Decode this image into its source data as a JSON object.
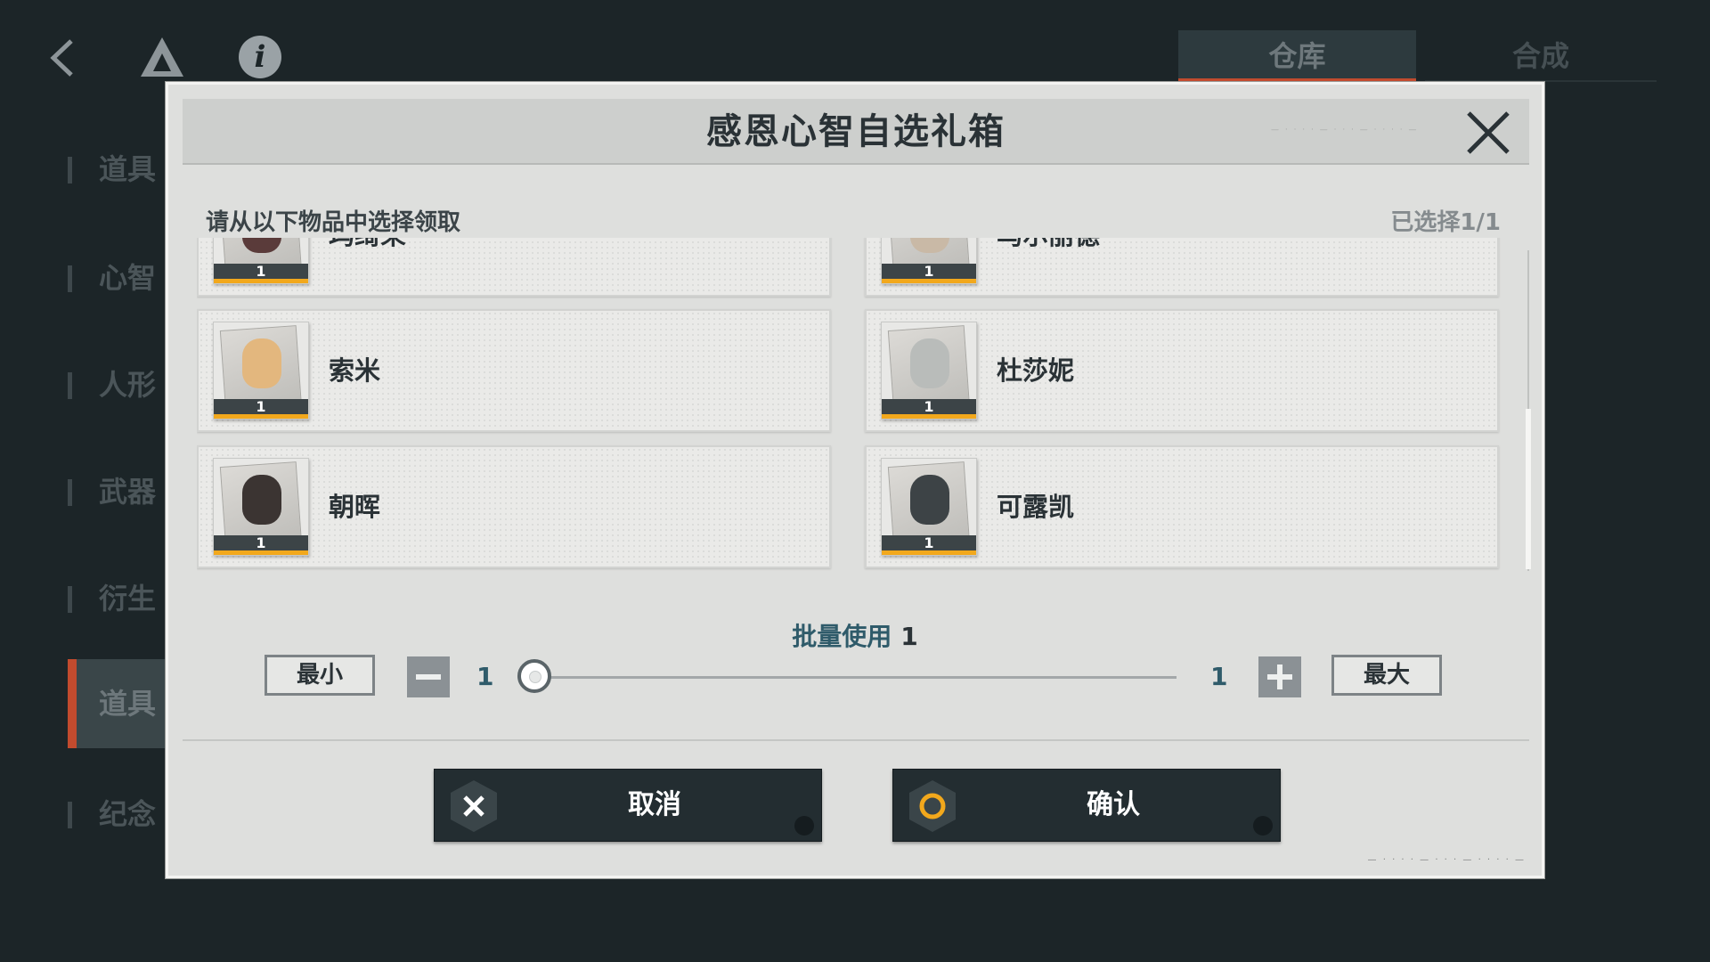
{
  "background": {
    "tabs": [
      {
        "label": "仓库",
        "active": true
      },
      {
        "label": "合成",
        "active": false
      }
    ],
    "sidebar": [
      {
        "label": "道具",
        "active": false
      },
      {
        "label": "心智",
        "active": false
      },
      {
        "label": "人形",
        "active": false
      },
      {
        "label": "武器",
        "active": false
      },
      {
        "label": "衍生",
        "active": false
      },
      {
        "label": "道具",
        "active": true
      },
      {
        "label": "纪念",
        "active": false
      }
    ]
  },
  "dialog": {
    "title": "感恩心智自选礼箱",
    "prompt": "请从以下物品中选择领取",
    "selected_count": "已选择1/1",
    "items": [
      {
        "name": "玛绮朵",
        "quantity": "1"
      },
      {
        "name": "乌尔丽德",
        "quantity": "1"
      },
      {
        "name": "索米",
        "quantity": "1"
      },
      {
        "name": "杜莎妮",
        "quantity": "1"
      },
      {
        "name": "朝晖",
        "quantity": "1"
      },
      {
        "name": "可露凯",
        "quantity": "1"
      }
    ],
    "batch": {
      "label": "批量使用",
      "value": "1",
      "min_label": "最小",
      "max_label": "最大",
      "slider_min": "1",
      "slider_max": "1",
      "slider_position": 0
    },
    "cancel_label": "取消",
    "confirm_label": "确认"
  },
  "colors": {
    "accent_orange": "#f2a81c",
    "tab_underline": "#c24b2e",
    "button_dark": "#232d31",
    "batch_text": "#2f5b6a"
  }
}
